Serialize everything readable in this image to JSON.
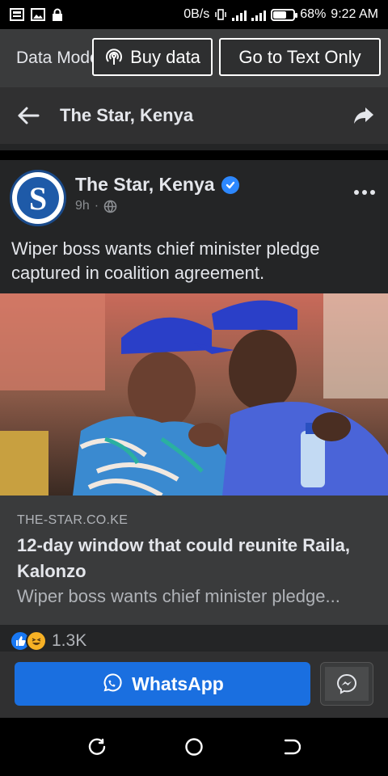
{
  "status_bar": {
    "net_speed": "0B/s",
    "battery": "68%",
    "battery_level": 0.68,
    "time": "9:22 AM"
  },
  "data_bar": {
    "label": "Data Mode",
    "buy_data": "Buy data",
    "text_only": "Go to Text Only"
  },
  "nav": {
    "title": "The Star, Kenya"
  },
  "post": {
    "page_name": "The Star, Kenya",
    "avatar_letter": "S",
    "time": "9h",
    "separator": "·",
    "caption": "Wiper boss wants chief minister pledge captured in coalition agreement.",
    "link": {
      "domain": "THE-STAR.CO.KE",
      "title": "12-day window that could reunite Raila, Kalonzo",
      "description": "Wiper boss wants chief minister pledge..."
    },
    "reactions_count": "1.3K"
  },
  "share": {
    "whatsapp": "WhatsApp"
  },
  "colors": {
    "accent": "#1a6fe0",
    "verified": "#2d88ff",
    "surface": "#242526"
  }
}
